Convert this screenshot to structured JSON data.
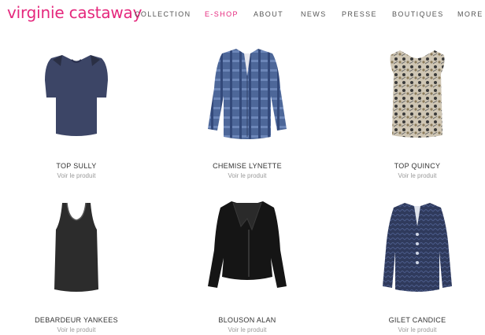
{
  "brand": {
    "name": "virginie castaway",
    "accent": "#e5287d"
  },
  "nav": {
    "items": [
      {
        "label": "COLLECTION",
        "active": false
      },
      {
        "label": "E-SHOP",
        "active": true
      },
      {
        "label": "ABOUT",
        "active": false
      },
      {
        "label": "NEWS",
        "active": false
      },
      {
        "label": "PRESSE",
        "active": false
      },
      {
        "label": "BOUTIQUES",
        "active": false
      },
      {
        "label": "MORE",
        "active": false
      }
    ]
  },
  "products": [
    {
      "name": "TOP SULLY",
      "link": "Voir le produit",
      "icon": "navy-blouse-image"
    },
    {
      "name": "CHEMISE LYNETTE",
      "link": "Voir le produit",
      "icon": "plaid-shirt-image"
    },
    {
      "name": "TOP QUINCY",
      "link": "Voir le produit",
      "icon": "printed-top-image"
    },
    {
      "name": "DEBARDEUR YANKEES",
      "link": "Voir le produit",
      "icon": "tank-top-image"
    },
    {
      "name": "BLOUSON ALAN",
      "link": "Voir le produit",
      "icon": "leather-jacket-image"
    },
    {
      "name": "GILET CANDICE",
      "link": "Voir le produit",
      "icon": "cardigan-image"
    }
  ]
}
